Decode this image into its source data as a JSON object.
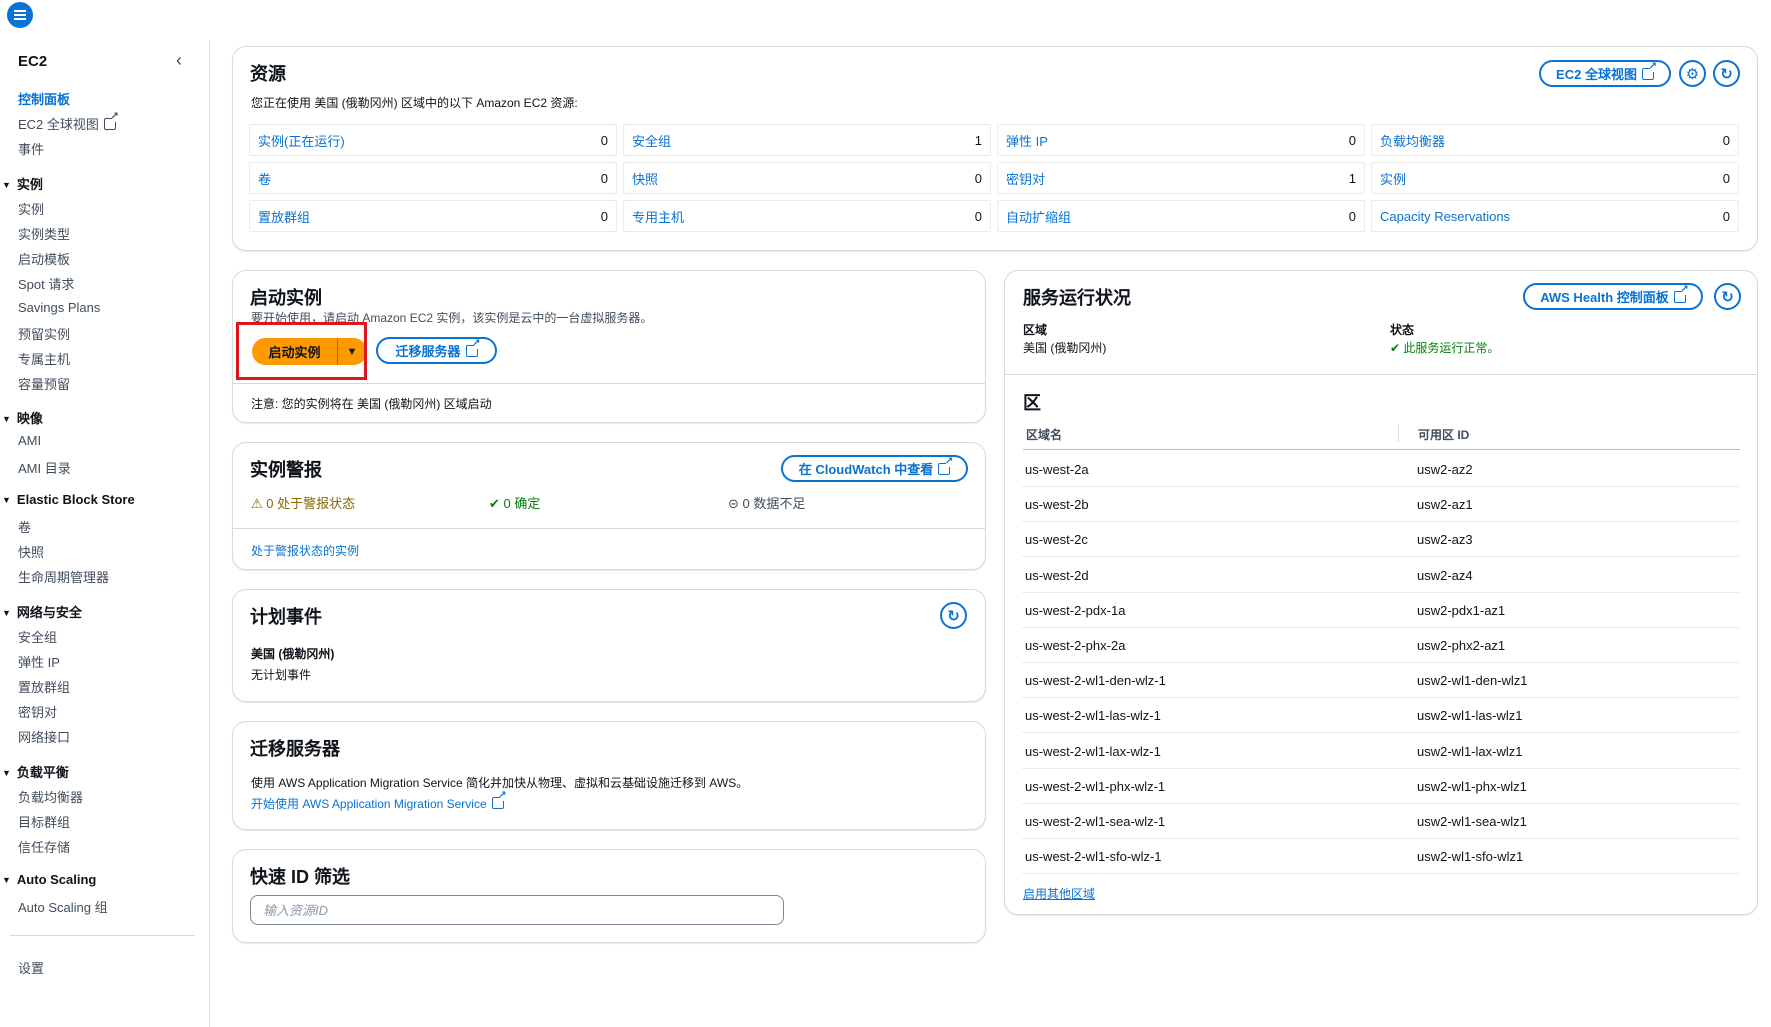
{
  "sidebar": {
    "title": "EC2",
    "items_top": [
      {
        "label": "控制面板",
        "active": true
      },
      {
        "label": "EC2 全球视图",
        "external": true
      },
      {
        "label": "事件"
      }
    ],
    "sections": [
      {
        "title": "实例",
        "items": [
          "实例",
          "实例类型",
          "启动模板",
          "Spot 请求",
          "Savings Plans",
          "预留实例",
          "专属主机",
          "容量预留"
        ]
      },
      {
        "title": "映像",
        "items": [
          "AMI",
          "AMI 目录"
        ]
      },
      {
        "title": "Elastic Block Store",
        "items": [
          "卷",
          "快照",
          "生命周期管理器"
        ]
      },
      {
        "title": "网络与安全",
        "items": [
          "安全组",
          "弹性 IP",
          "置放群组",
          "密钥对",
          "网络接口"
        ]
      },
      {
        "title": "负载平衡",
        "items": [
          "负载均衡器",
          "目标群组",
          "信任存储"
        ]
      },
      {
        "title": "Auto Scaling",
        "items": [
          "Auto Scaling 组"
        ]
      }
    ],
    "settings": "设置"
  },
  "resources": {
    "title": "资源",
    "subtitle": "您正在使用 美国 (俄勒冈州) 区域中的以下 Amazon EC2 资源:",
    "global_view_btn": "EC2 全球视图",
    "cells": [
      [
        {
          "label": "实例(正在运行)",
          "value": "0"
        },
        {
          "label": "安全组",
          "value": "1"
        },
        {
          "label": "弹性 IP",
          "value": "0"
        },
        {
          "label": "负载均衡器",
          "value": "0"
        }
      ],
      [
        {
          "label": "卷",
          "value": "0"
        },
        {
          "label": "快照",
          "value": "0"
        },
        {
          "label": "密钥对",
          "value": "1"
        },
        {
          "label": "实例",
          "value": "0"
        }
      ],
      [
        {
          "label": "置放群组",
          "value": "0"
        },
        {
          "label": "专用主机",
          "value": "0"
        },
        {
          "label": "自动扩缩组",
          "value": "0"
        },
        {
          "label": "Capacity Reservations",
          "value": "0"
        }
      ]
    ]
  },
  "launch": {
    "title": "启动实例",
    "desc": "要开始使用，请启动 Amazon EC2 实例，该实例是云中的一台虚拟服务器。",
    "launch_btn": "启动实例",
    "migrate_btn": "迁移服务器",
    "note": "注意: 您的实例将在 美国 (俄勒冈州) 区域启动"
  },
  "alarms": {
    "title": "实例警报",
    "cloudwatch_btn": "在 CloudWatch 中查看",
    "in_alarm": "0 处于警报状态",
    "ok": "0 确定",
    "insufficient": "0 数据不足",
    "link": "处于警报状态的实例"
  },
  "scheduled": {
    "title": "计划事件",
    "region": "美国 (俄勒冈州)",
    "none": "无计划事件"
  },
  "migrate": {
    "title": "迁移服务器",
    "desc": "使用 AWS Application Migration Service 简化并加快从物理、虚拟和云基础设施迁移到 AWS。",
    "link": "开始使用 AWS Application Migration Service"
  },
  "quick_id": {
    "title": "快速 ID 筛选",
    "placeholder": "输入资源ID"
  },
  "health": {
    "title": "服务运行状况",
    "dashboard_btn": "AWS Health 控制面板",
    "region_label": "区域",
    "region_value": "美国 (俄勒冈州)",
    "status_label": "状态",
    "status_value": "此服务运行正常。"
  },
  "zones": {
    "title": "区",
    "col_name": "区域名",
    "col_id": "可用区 ID",
    "rows": [
      [
        "us-west-2a",
        "usw2-az2"
      ],
      [
        "us-west-2b",
        "usw2-az1"
      ],
      [
        "us-west-2c",
        "usw2-az3"
      ],
      [
        "us-west-2d",
        "usw2-az4"
      ],
      [
        "us-west-2-pdx-1a",
        "usw2-pdx1-az1"
      ],
      [
        "us-west-2-phx-2a",
        "usw2-phx2-az1"
      ],
      [
        "us-west-2-wl1-den-wlz-1",
        "usw2-wl1-den-wlz1"
      ],
      [
        "us-west-2-wl1-las-wlz-1",
        "usw2-wl1-las-wlz1"
      ],
      [
        "us-west-2-wl1-lax-wlz-1",
        "usw2-wl1-lax-wlz1"
      ],
      [
        "us-west-2-wl1-phx-wlz-1",
        "usw2-wl1-phx-wlz1"
      ],
      [
        "us-west-2-wl1-sea-wlz-1",
        "usw2-wl1-sea-wlz1"
      ],
      [
        "us-west-2-wl1-sfo-wlz-1",
        "usw2-wl1-sfo-wlz1"
      ]
    ],
    "enable_link": "启用其他区域"
  },
  "colors": {
    "primary": "#0972d3",
    "launch": "#ff9900",
    "highlight": "#e0161e",
    "ok": "#037f0c"
  }
}
